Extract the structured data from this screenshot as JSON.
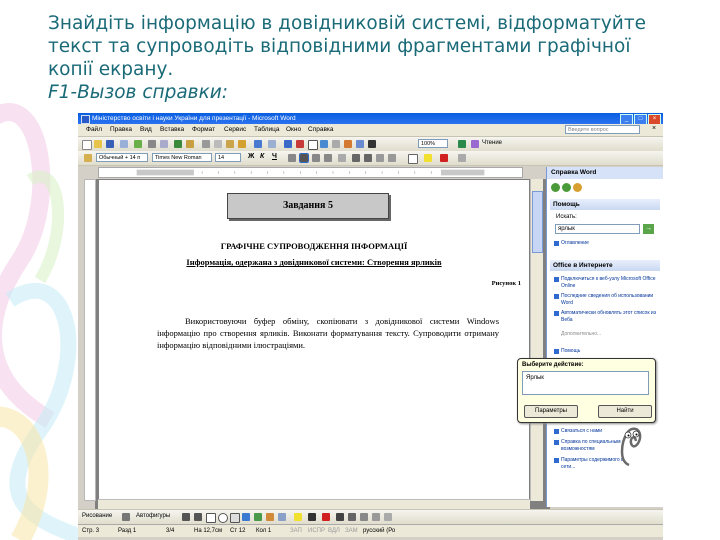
{
  "slide": {
    "heading_lines": [
      "Знайдіть інформацію в довідниковій системі, відформатуйте",
      "текст  та супроводіть відповідними фрагментами графічної",
      "копії екрану.",
      "F1-Вызов справки:"
    ]
  },
  "window": {
    "title": "Міністерство освіти і науки України для презентації - Microsoft Word",
    "minimize": "_",
    "maximize": "□",
    "close": "×"
  },
  "menu": {
    "items": [
      "Файл",
      "Правка",
      "Вид",
      "Вставка",
      "Формат",
      "Сервис",
      "Таблица",
      "Окно",
      "Справка"
    ],
    "ask_placeholder": "Введите вопрос",
    "close": "×"
  },
  "toolbar": {
    "zoom": "100%",
    "read_label": "Чтение",
    "style": "Обычный + 14 п",
    "font": "Times New Roman",
    "size": "14",
    "bold": "Ж",
    "italic": "К",
    "underline": "Ч"
  },
  "document": {
    "box_title": "Завдання 5",
    "heading1": "ГРАФІЧНЕ СУПРОВОДЖЕННЯ ІНФОРМАЦІЇ",
    "heading2": "Інформація, одержана з довідникової системи: Створення ярликів",
    "figure_label": "Рисунок 1",
    "paragraph": "Використовуючи буфер обміну, скопіювати з довідникової системи Windows інформацію про створення ярликів. Виконати форматування тексту. Супроводити отриману інформацію відповідними ілюстраціями."
  },
  "taskpane": {
    "title": "Справка Word",
    "section_help": "Помощь",
    "search_label": "Искать:",
    "search_value": "ярлык",
    "toc_link": "Оглавление",
    "section_online": "Office в Интернете",
    "links": [
      "Подключиться к веб-узлу Microsoft Office Online",
      "Последние сведения об использовании Word",
      "Автоматически обновлять этот список из Веба"
    ],
    "more": "Дополнительно...",
    "help_link": "Помощь",
    "bottom_links": [
      "Связаться с нами",
      "Справка по специальным возможностям",
      "Параметры содержимого в сети..."
    ]
  },
  "assistant": {
    "title": "Выберите действие:",
    "input_value": "Ярлык",
    "options_button": "Параметры",
    "search_button": "Найти"
  },
  "drawing": {
    "draw_label": "Рисование",
    "autoshapes_label": "Автофигуры"
  },
  "status": {
    "page": "Стр. 3",
    "section": "Разд 1",
    "pages": "3/4",
    "at": "На 12,7см",
    "line": "Ст 12",
    "col": "Кол 1",
    "rec": "ЗАП",
    "trk": "ИСПР",
    "ext": "ВДЛ",
    "ovr": "ЗАМ",
    "lang": "русский (Ро"
  },
  "colors": {
    "heading": "#1a6a78",
    "titlebar": "#0a5fe0",
    "link": "#003399"
  }
}
